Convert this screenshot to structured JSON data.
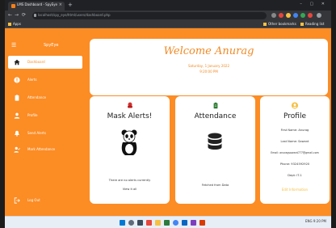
{
  "browser": {
    "tab_title": "LMS Dashboard - SpyEye",
    "tab_close": "×",
    "new_tab": "+",
    "window_controls": "– ▢ ✕",
    "url": "localhost/spy_eye/html/users/dashboard.php",
    "back": "←",
    "forward": "→",
    "reload": "⟳",
    "home": "⌂",
    "bookmarks": [
      "Apps",
      "Other bookmarks",
      "Reading list"
    ]
  },
  "sidebar": {
    "menu_icon": "☰",
    "brand": "SpyEye",
    "items": [
      {
        "label": "Dashboard",
        "icon": "home-icon",
        "active": true
      },
      {
        "label": "Alerts",
        "icon": "alert-icon",
        "active": false
      },
      {
        "label": "Attendance",
        "icon": "clipboard-icon",
        "active": false
      },
      {
        "label": "Profile",
        "icon": "user-icon",
        "active": false
      },
      {
        "label": "Send Alerts",
        "icon": "bell-icon",
        "active": false
      },
      {
        "label": "Mark Attendance",
        "icon": "user-check-icon",
        "active": false
      }
    ],
    "logout": "Log Out"
  },
  "welcome": {
    "title": "Welcome Anurag",
    "date": "Saturday, 1 January 2022",
    "time": "9:20:00 PM"
  },
  "cards": {
    "mask": {
      "title": "Mask Alerts!",
      "message": "There are no alerts currently",
      "link": "View it all"
    },
    "attendance": {
      "title": "Attendance",
      "status": "Fetched from Data"
    },
    "profile": {
      "title": "Profile",
      "first_name": "First Name: Anurag",
      "last_name": "Last Name: Sawant",
      "email": "Email: anuragsawant777@gmail.com",
      "phone": "Phone: 9324592920",
      "dept": "Dept: IT-1",
      "link": "Edit Information"
    }
  },
  "taskbar": {
    "tray": "ENG  9:20 PM"
  },
  "colors": {
    "accent": "#fc8c24",
    "card": "#ffffff",
    "welcome_text": "#f08a25",
    "link": "#f6c042"
  }
}
